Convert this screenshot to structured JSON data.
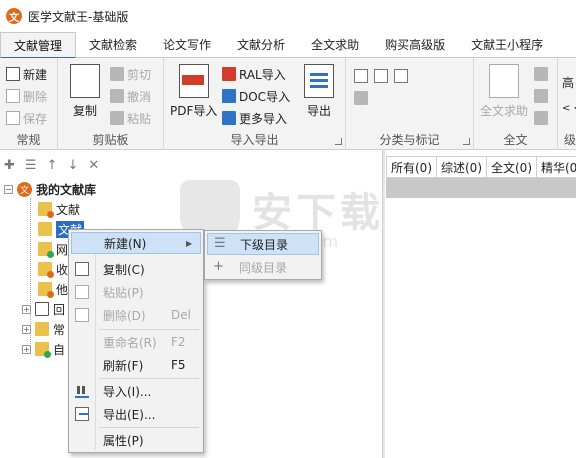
{
  "window": {
    "title": "医学文献王-基础版",
    "logo_glyph": "文"
  },
  "tabs": [
    "文献管理",
    "文献检索",
    "论文写作",
    "文献分析",
    "全文求助",
    "购买高级版",
    "文献王小程序"
  ],
  "ribbon": {
    "groups": {
      "common": "常规",
      "clipboard": "剪贴板",
      "import_export": "导入导出",
      "classify": "分类与标记",
      "fulltext": "全文",
      "level": "级"
    },
    "common": {
      "new": "新建",
      "delete": "删除",
      "save": "保存"
    },
    "clipboard": {
      "copy": "复制",
      "cut": "剪切",
      "undo": "撤消",
      "paste": "粘贴"
    },
    "import_export": {
      "pdf_import": "PDF导入",
      "ral_import": "RAL导入",
      "doc_import": "DOC导入",
      "more_import": "更多导入",
      "export": "导出"
    },
    "fulltext": {
      "fulltext_help": "全文求助",
      "high": "高",
      "arrows": "< <"
    }
  },
  "tree": {
    "root": "我的文献库",
    "root_logo": "文",
    "nodes": [
      "文献",
      "文献",
      "网",
      "收",
      "他",
      "回",
      "常",
      "自"
    ]
  },
  "right_tabs": [
    "所有(0)",
    "综述(0)",
    "全文(0)",
    "精华(0"
  ],
  "context_menu": {
    "items": [
      {
        "label": "新建(N)",
        "shortcut": "",
        "arrow": "▶"
      },
      {
        "label": "复制(C)",
        "shortcut": ""
      },
      {
        "label": "粘贴(P)",
        "shortcut": ""
      },
      {
        "label": "删除(D)",
        "shortcut": "Del"
      },
      {
        "label": "重命名(R)",
        "shortcut": "F2"
      },
      {
        "label": "刷新(F)",
        "shortcut": "F5"
      },
      {
        "label": "导入(I)...",
        "shortcut": ""
      },
      {
        "label": "导出(E)...",
        "shortcut": ""
      },
      {
        "label": "属性(P)",
        "shortcut": ""
      }
    ]
  },
  "submenu": {
    "items": [
      "下级目录",
      "同级目录"
    ]
  },
  "watermark": {
    "text": "安下载",
    "sub": "anxz.com"
  },
  "colors": {
    "accent": "#2b6cc4",
    "brand": "#e06a1b",
    "highlight": "#cde1f7"
  }
}
